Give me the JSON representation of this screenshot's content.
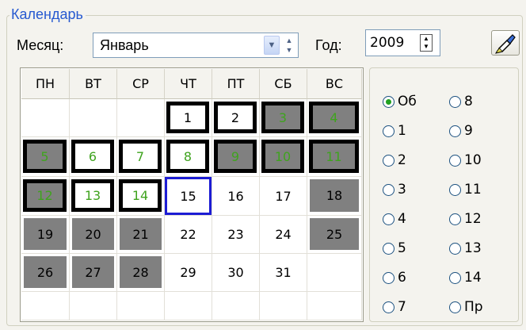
{
  "group_title": "Календарь",
  "month_label": "Месяц:",
  "month_value": "Январь",
  "year_label": "Год:",
  "year_value": "2009",
  "weekdays": [
    "ПН",
    "ВТ",
    "СР",
    "ЧТ",
    "ПТ",
    "СБ",
    "ВС"
  ],
  "weeks": [
    [
      "",
      "",
      "",
      "1",
      "2",
      "3",
      "4"
    ],
    [
      "5",
      "6",
      "7",
      "8",
      "9",
      "10",
      "11"
    ],
    [
      "12",
      "13",
      "14",
      "15",
      "16",
      "17",
      "18"
    ],
    [
      "19",
      "20",
      "21",
      "22",
      "23",
      "24",
      "25"
    ],
    [
      "26",
      "27",
      "28",
      "29",
      "30",
      "31",
      ""
    ],
    [
      "",
      "",
      "",
      "",
      "",
      "",
      ""
    ]
  ],
  "styles": [
    [
      "",
      "",
      "",
      "thick",
      "thick",
      "thick gray green",
      "thick gray green"
    ],
    [
      "thick gray green",
      "thick green",
      "thick green",
      "thick green",
      "thick gray green",
      "thick gray green",
      "thick gray green"
    ],
    [
      "thick gray green",
      "thick green",
      "thick green",
      "today",
      "",
      "",
      "gray"
    ],
    [
      "gray",
      "gray",
      "gray",
      "",
      "",
      "",
      "gray"
    ],
    [
      "gray",
      "gray",
      "gray",
      "",
      "",
      "",
      ""
    ],
    [
      "",
      "",
      "",
      "",
      "",
      "",
      ""
    ]
  ],
  "radios_col1": [
    "Об",
    "1",
    "2",
    "3",
    "4",
    "5",
    "6",
    "7"
  ],
  "radios_col2": [
    "8",
    "9",
    "10",
    "11",
    "12",
    "13",
    "14",
    "Пр"
  ],
  "radio_selected": "Об",
  "colors": {
    "accent_blue": "#2659d0",
    "green_text": "#3fa31e",
    "gray_cell": "#808080",
    "today_border": "#1c1cd4"
  }
}
